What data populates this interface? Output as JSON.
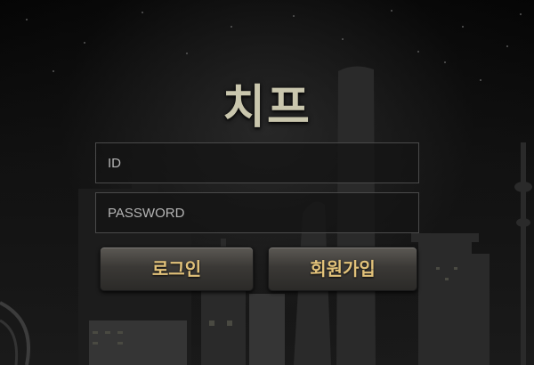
{
  "brand": {
    "title": "치프"
  },
  "login_form": {
    "id_placeholder": "ID",
    "password_placeholder": "PASSWORD",
    "login_label": "로그인",
    "signup_label": "회원가입"
  },
  "colors": {
    "title": "#c9c6ad",
    "button_text": "#e2c27a",
    "field_border": "#4a4a4a"
  }
}
